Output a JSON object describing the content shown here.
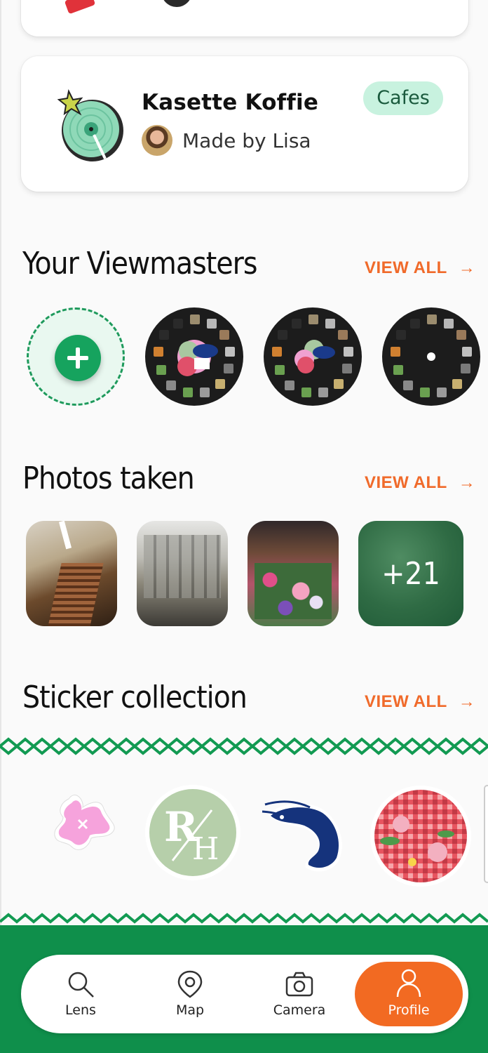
{
  "place_card": {
    "title": "Kasette Koffie",
    "made_by": "Made by Lisa",
    "tag": "Cafes"
  },
  "viewmasters": {
    "title": "Your Viewmasters",
    "view_all": "VIEW ALL",
    "add_label": "",
    "reel_count": 3
  },
  "photos": {
    "title": "Photos taken",
    "view_all": "VIEW ALL",
    "more_count": "+21"
  },
  "stickers": {
    "title": "Sticker collection",
    "view_all": "VIEW ALL",
    "items": [
      "pink-splat-sticker",
      "rh-logo-sticker",
      "shrimp-sticker",
      "tablecloth-sticker"
    ]
  },
  "nav": {
    "items": [
      {
        "label": "Lens",
        "icon": "lens-icon",
        "active": false
      },
      {
        "label": "Map",
        "icon": "map-pin-icon",
        "active": false
      },
      {
        "label": "Camera",
        "icon": "camera-icon",
        "active": false
      },
      {
        "label": "Profile",
        "icon": "profile-icon",
        "active": true
      }
    ]
  },
  "colors": {
    "accent_orange": "#f26a22",
    "brand_green": "#0f8f4b",
    "tag_bg": "#c8f2df"
  }
}
